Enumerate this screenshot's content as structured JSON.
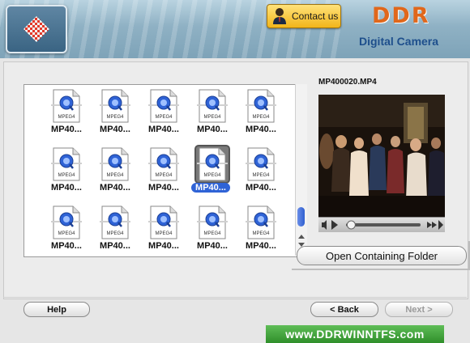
{
  "header": {
    "contact_label": "Contact us",
    "brand": "DDR",
    "subtitle": "Digital Camera"
  },
  "files": [
    {
      "name": "MP40...",
      "badge": "MPEG4",
      "selected": false
    },
    {
      "name": "MP40...",
      "badge": "MPEG4",
      "selected": false
    },
    {
      "name": "MP40...",
      "badge": "MPEG4",
      "selected": false
    },
    {
      "name": "MP40...",
      "badge": "MPEG4",
      "selected": false
    },
    {
      "name": "MP40...",
      "badge": "MPEG4",
      "selected": false
    },
    {
      "name": "MP40...",
      "badge": "MPEG4",
      "selected": false
    },
    {
      "name": "MP40...",
      "badge": "MPEG4",
      "selected": false
    },
    {
      "name": "MP40...",
      "badge": "MPEG4",
      "selected": false
    },
    {
      "name": "MP40...",
      "badge": "MPEG4",
      "selected": true
    },
    {
      "name": "MP40...",
      "badge": "MPEG4",
      "selected": false
    },
    {
      "name": "MP40...",
      "badge": "MPEG4",
      "selected": false
    },
    {
      "name": "MP40...",
      "badge": "MPEG4",
      "selected": false
    },
    {
      "name": "MP40...",
      "badge": "MPEG4",
      "selected": false
    },
    {
      "name": "MP40...",
      "badge": "MPEG4",
      "selected": false
    },
    {
      "name": "MP40...",
      "badge": "MPEG4",
      "selected": false
    }
  ],
  "preview": {
    "filename": "MP400020.MP4",
    "playback_position": 0.05
  },
  "buttons": {
    "open_folder": "Open Containing Folder",
    "help": "Help",
    "back": "< Back",
    "next": "Next >"
  },
  "footer": {
    "url": "www.DDRWINNTFS.com"
  },
  "colors": {
    "brand": "#e0671b",
    "subtitle": "#1e4f8c",
    "selection": "#2f63d6",
    "url_bar": "#2f8f2a"
  }
}
